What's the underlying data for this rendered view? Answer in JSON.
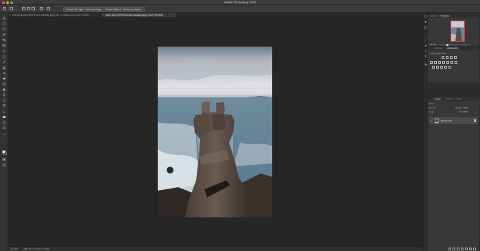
{
  "window": {
    "title": "Adobe Photoshop 2020"
  },
  "options_bar": {
    "buttons": [
      "Sample All Layers",
      "Enhance Edge",
      "Select Subject",
      "Select and Mask..."
    ]
  },
  "tabs": [
    {
      "label": "thought-npuskp-Wy5R4Dl2o-unsplash.jpg @ 66.7% (Background copy, RGB/8)"
    },
    {
      "label": "pepiu-pepiu-WPoIOhOxqfc-unsplash.jpg @ 33.3% (RGB/8)"
    }
  ],
  "status_bar": {
    "zoom": "33.33%",
    "doc_info": "3840 px x 5760 px (72 ppi)"
  },
  "navigator_panel": {
    "tabs": [
      "Histogram",
      "Navigator"
    ],
    "zoom_value": "33.33%"
  },
  "adjustments_panel": {
    "tabs": [
      "Libraries",
      "Adjustments"
    ],
    "label": "Add an adjustment"
  },
  "layers_panel": {
    "tabs": [
      "Layers",
      "Channels",
      "Paths"
    ],
    "kind_label": "Kind",
    "blend_mode": "Normal",
    "opacity_label": "Opacity: 100%",
    "lock_label": "Lock:",
    "fill_label": "Fill: 100%",
    "layers": [
      {
        "name": "Background"
      }
    ]
  },
  "colors": {
    "foreground": "#ffffff",
    "background": "#111111",
    "accent": "#d33333"
  }
}
